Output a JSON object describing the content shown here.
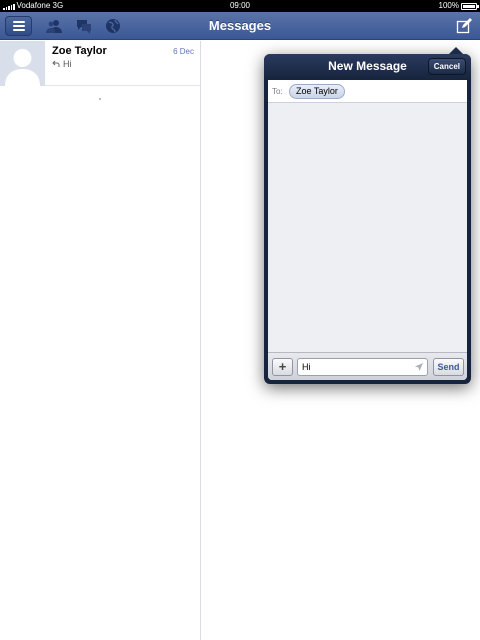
{
  "status_bar": {
    "carrier": "Vodafone 3G",
    "time": "09:00",
    "battery": "100%"
  },
  "nav_bar": {
    "title": "Messages",
    "icons": [
      "menu-icon",
      "friend-requests-icon",
      "messages-icon",
      "notifications-globe-icon",
      "compose-icon"
    ]
  },
  "threads": [
    {
      "name": "Zoe Taylor",
      "date": "6 Dec",
      "snippet": "Hi",
      "reply_icon": "reply-arrow-icon"
    }
  ],
  "new_message": {
    "title": "New Message",
    "cancel_label": "Cancel",
    "to_label": "To:",
    "recipient": "Zoe Taylor",
    "message_value": "Hi",
    "send_label": "Send",
    "attach_label": "+"
  },
  "colors": {
    "nav_blue": "#3b5896",
    "popover_dark": "#17243d",
    "link_blue": "#5a77b0"
  }
}
